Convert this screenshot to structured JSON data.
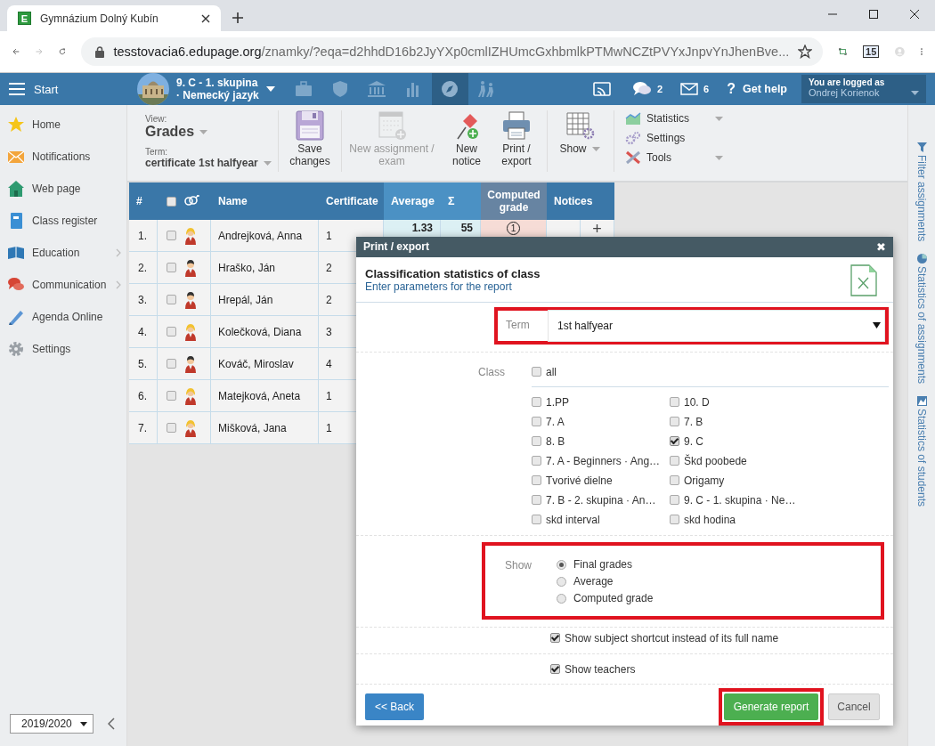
{
  "browser": {
    "favicon_letter": "E",
    "tab_title": "Gymnázium Dolný Kubín",
    "url_host": "tesstovacia6.edupage.org",
    "url_path": "/znamky/?eqa=d2hhdD16b2JyYXp0cmlIZHUmcGxhbmlkPTMwNCZtPVYxJnpvYnJhenBve...",
    "extension_badge": "15"
  },
  "header": {
    "start_label": "Start",
    "class_line1": "9. C - 1. skupina",
    "class_line2": "· Nemecký jazyk",
    "nav_icons": [
      {
        "selected": false
      },
      {
        "selected": false
      },
      {
        "selected": false
      },
      {
        "selected": false
      },
      {
        "selected": true
      },
      {
        "selected": false
      }
    ],
    "chat_count": "2",
    "mail_count": "6",
    "help_mark": "?",
    "help_label": "Get help",
    "login_caption": "You are logged as",
    "login_user": "Ondrej Korienok"
  },
  "sidebar": {
    "items": [
      {
        "label": "Home",
        "submenu": false
      },
      {
        "label": "Notifications",
        "submenu": false
      },
      {
        "label": "Web page",
        "submenu": false
      },
      {
        "label": "Class register",
        "submenu": false
      },
      {
        "label": "Education",
        "submenu": true
      },
      {
        "label": "Communication",
        "submenu": true
      },
      {
        "label": "Agenda Online",
        "submenu": false
      },
      {
        "label": "Settings",
        "submenu": false
      }
    ],
    "year": "2019/2020"
  },
  "toolbar": {
    "view_caption": "View:",
    "view_value": "Grades",
    "term_caption": "Term:",
    "term_value": "certificate 1st halfyear",
    "buttons": [
      {
        "label": "Save changes",
        "disabled": false,
        "caret": false
      },
      {
        "label": "New assignment / exam",
        "disabled": true,
        "caret": false
      },
      {
        "label": "New notice",
        "disabled": false,
        "caret": false
      },
      {
        "label": "Print / export",
        "disabled": false,
        "caret": false
      },
      {
        "label": "Show",
        "disabled": false,
        "caret": true
      }
    ],
    "menu": [
      {
        "label": "Statistics",
        "caret": true
      },
      {
        "label": "Settings",
        "caret": false
      },
      {
        "label": "Tools",
        "caret": true
      }
    ]
  },
  "table": {
    "all_checked": false,
    "columns": [
      {
        "label": "#",
        "kind": "plain"
      },
      {
        "kind": "check"
      },
      {
        "label": "Name",
        "kind": "plain"
      },
      {
        "label": "Certificate",
        "kind": "plain"
      },
      {
        "label": "Average",
        "kind": "stat"
      },
      {
        "label": "Σ",
        "kind": "stat"
      },
      {
        "label": "Computed grade",
        "kind": "computed"
      },
      {
        "label": "Notices",
        "kind": "plain"
      }
    ],
    "rows": [
      {
        "number": "1.",
        "kind": "female",
        "checked": false,
        "name": "Andrejková, Anna",
        "certificate": "1",
        "average": "1.33",
        "sum": "55",
        "computed_grade": "1",
        "notice_add": "+"
      },
      {
        "number": "2.",
        "kind": "male",
        "checked": false,
        "name": "Hraško, Ján",
        "certificate": "2"
      },
      {
        "number": "3.",
        "kind": "male",
        "checked": false,
        "name": "Hrepál, Ján",
        "certificate": "2"
      },
      {
        "number": "4.",
        "kind": "female",
        "checked": false,
        "name": "Kolečková, Diana",
        "certificate": "3"
      },
      {
        "number": "5.",
        "kind": "male",
        "checked": false,
        "name": "Kováč, Miroslav",
        "certificate": "4"
      },
      {
        "number": "6.",
        "kind": "female",
        "checked": false,
        "name": "Matejková, Aneta",
        "certificate": "1"
      },
      {
        "number": "7.",
        "kind": "female",
        "checked": false,
        "name": "Mišková, Jana",
        "certificate": "1"
      }
    ]
  },
  "side_panel": [
    {
      "label": "Filter assignments"
    },
    {
      "label": "Statistics of assignments"
    },
    {
      "label": "Statistics of students"
    }
  ],
  "dialog": {
    "title": "Print / export",
    "close": "✖",
    "heading": "Classification statistics of class",
    "subheading": "Enter parameters for the report",
    "term": {
      "label": "Term",
      "value": "1st halfyear",
      "highlighted": true
    },
    "class": {
      "label": "Class",
      "all": {
        "label": "all",
        "checked": false
      },
      "options": [
        {
          "label": "1.PP",
          "checked": false
        },
        {
          "label": "10. D",
          "checked": false
        },
        {
          "label": "7. A",
          "checked": false
        },
        {
          "label": "7. B",
          "checked": false
        },
        {
          "label": "8. B",
          "checked": false
        },
        {
          "label": "9. C",
          "checked": true
        },
        {
          "label": "7. A - Beginners · Ang…",
          "checked": false
        },
        {
          "label": "Škd poobede",
          "checked": false
        },
        {
          "label": "Tvorivé dielne",
          "checked": false
        },
        {
          "label": "Origamy",
          "checked": false
        },
        {
          "label": "7. B - 2. skupina · An…",
          "checked": false
        },
        {
          "label": "9. C - 1. skupina · Ne…",
          "checked": false
        },
        {
          "label": "skd interval",
          "checked": false
        },
        {
          "label": "skd hodina",
          "checked": false
        }
      ]
    },
    "show": {
      "label": "Show",
      "highlighted": true,
      "options": [
        {
          "label": "Final grades",
          "selected": true
        },
        {
          "label": "Average",
          "selected": false
        },
        {
          "label": "Computed grade",
          "selected": false
        }
      ]
    },
    "toggles": [
      {
        "label": "Show subject shortcut instead of its full name",
        "checked": true
      },
      {
        "label": "Show teachers",
        "checked": true
      }
    ],
    "back": "<< Back",
    "generate": {
      "label": "Generate report",
      "highlighted": true
    },
    "cancel": "Cancel"
  }
}
